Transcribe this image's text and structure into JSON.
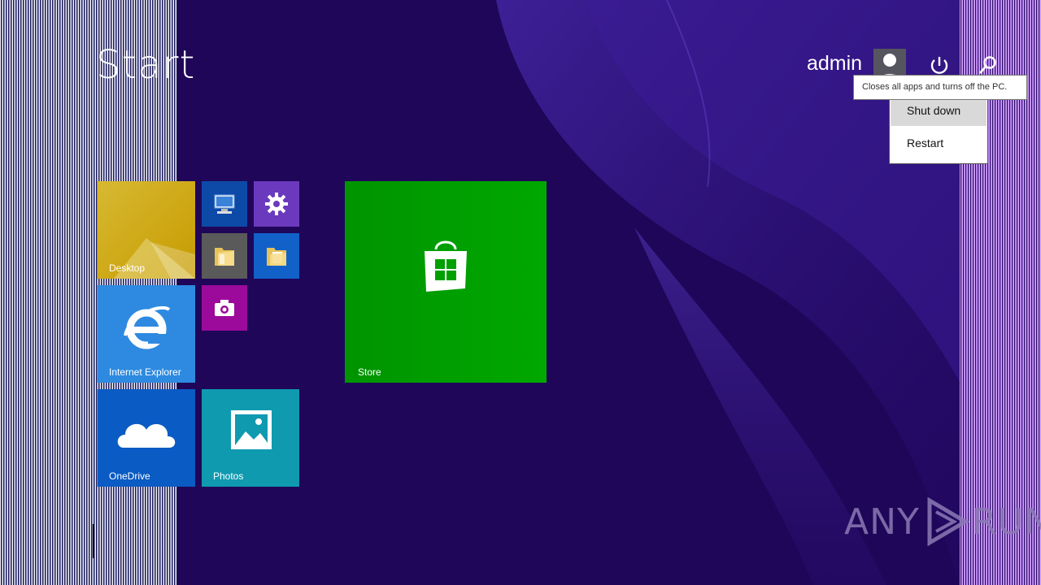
{
  "start": {
    "title": "Start"
  },
  "user": {
    "name": "admin"
  },
  "icons": {
    "avatar": "user-icon",
    "power": "power-icon",
    "search": "search-icon"
  },
  "tiles": {
    "desktop": {
      "label": "Desktop",
      "color": "#c8a400"
    },
    "this_pc": {
      "icon": "computer-icon",
      "color": "#0d4aa8"
    },
    "pc_settings": {
      "icon": "gear-icon",
      "color": "#6b39bd"
    },
    "file_explorer": {
      "icon": "folder-icon",
      "color": "#5a5a5a"
    },
    "documents": {
      "icon": "folder-icon",
      "color": "#1261c9"
    },
    "camera": {
      "icon": "camera-icon",
      "color": "#9c0a9c"
    },
    "internet_explorer": {
      "label": "Internet Explorer",
      "color": "#2d8ae0"
    },
    "onedrive": {
      "label": "OneDrive",
      "color": "#0a5bc4"
    },
    "photos": {
      "label": "Photos",
      "color": "#0f9ab0"
    },
    "store": {
      "label": "Store",
      "color": "#00a300"
    }
  },
  "power_menu": {
    "tooltip": "Closes all apps and turns off the PC.",
    "items": [
      {
        "label": "Shut down",
        "hovered": true
      },
      {
        "label": "Restart",
        "hovered": false
      }
    ]
  },
  "watermark": {
    "text": "ANY",
    "text2": "RUN"
  },
  "colors": {
    "background": "#1f0658",
    "menu_hover": "#d9d9d9"
  }
}
